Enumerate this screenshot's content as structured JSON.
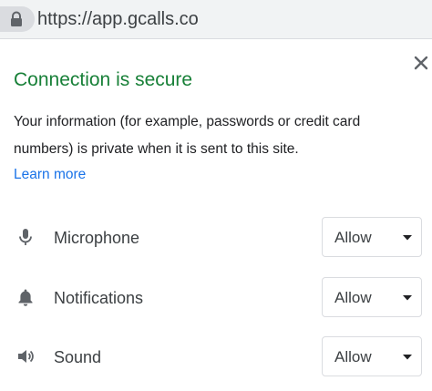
{
  "address_bar": {
    "url": "https://app.gcalls.co",
    "lock_icon": "lock-icon"
  },
  "popup": {
    "title": "Connection is secure",
    "description": "Your information (for example, passwords or credit card numbers) is private when it is sent to this site.",
    "learn_more": "Learn more",
    "close_icon": "close-icon",
    "colors": {
      "title": "#188038",
      "link": "#1a73e8"
    }
  },
  "permissions": [
    {
      "label": "Microphone",
      "icon": "microphone-icon",
      "value": "Allow"
    },
    {
      "label": "Notifications",
      "icon": "bell-icon",
      "value": "Allow"
    },
    {
      "label": "Sound",
      "icon": "speaker-icon",
      "value": "Allow"
    }
  ]
}
